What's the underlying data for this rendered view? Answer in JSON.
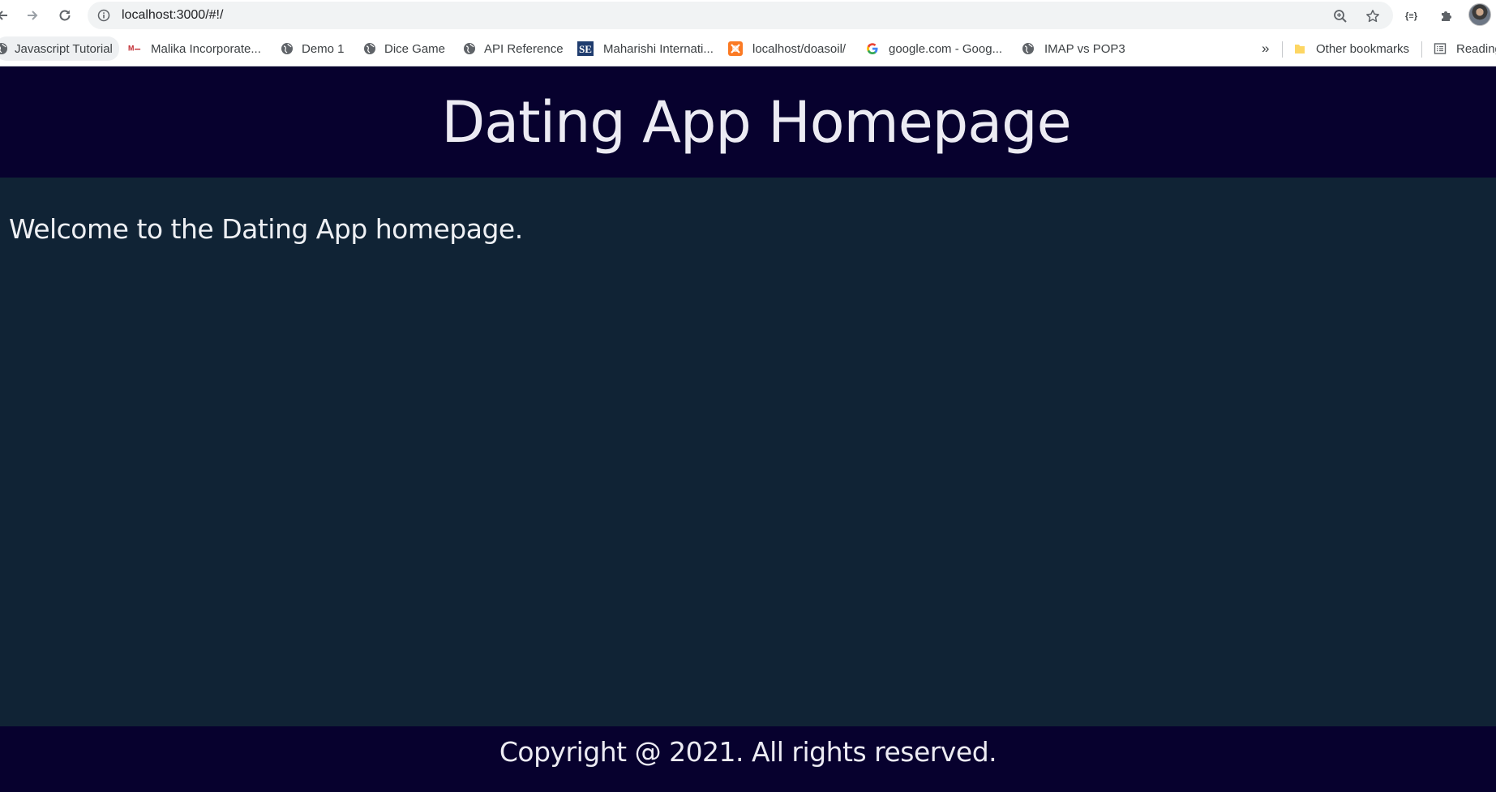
{
  "browser": {
    "url": "localhost:3000/#!/",
    "bookmarks": [
      {
        "label": "Javascript Tutorial",
        "icon": "globe-icon"
      },
      {
        "label": "Malika Incorporate...",
        "icon": "malika-logo-icon"
      },
      {
        "label": "Demo 1",
        "icon": "globe-icon"
      },
      {
        "label": "Dice Game",
        "icon": "globe-icon"
      },
      {
        "label": "API Reference",
        "icon": "globe-icon"
      },
      {
        "label": "Maharishi Internati...",
        "icon": "se-logo-icon"
      },
      {
        "label": "localhost/doasoil/",
        "icon": "xampp-icon"
      },
      {
        "label": "google.com - Goog...",
        "icon": "google-icon"
      },
      {
        "label": "IMAP vs POP3",
        "icon": "globe-icon"
      }
    ],
    "overflow_label": "»",
    "other_bookmarks": "Other bookmarks",
    "reading_list": "Reading"
  },
  "page": {
    "title": "Dating App Homepage",
    "welcome": "Welcome to the Dating App homepage.",
    "footer": "Copyright @ 2021. All rights reserved."
  },
  "colors": {
    "header_bg": "#07012e",
    "content_bg": "#102335",
    "text": "#ecebf3"
  }
}
